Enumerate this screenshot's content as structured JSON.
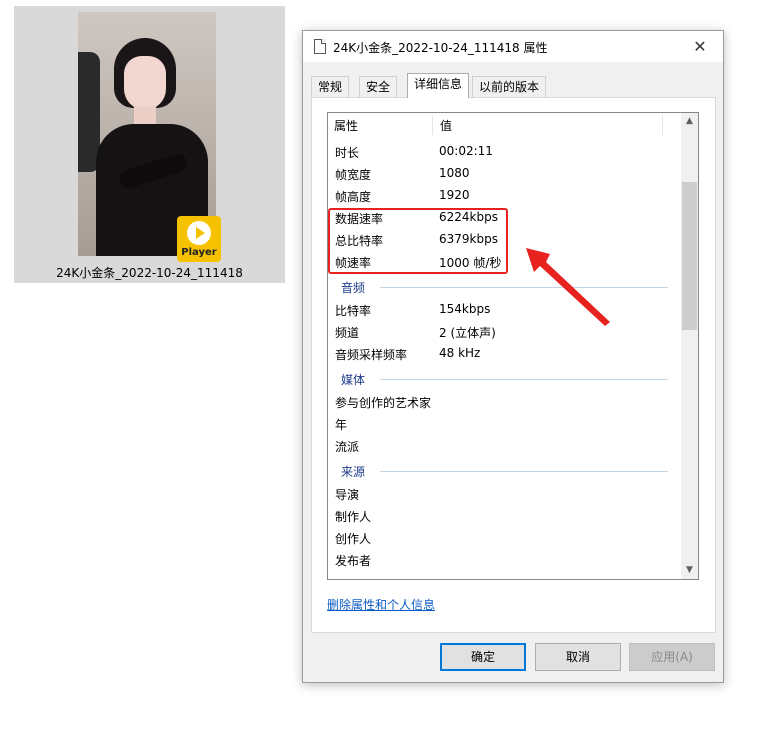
{
  "file": {
    "name": "24K小金条_2022-10-24_111418",
    "badge_label": "Player",
    "badge_color": "#f6c200"
  },
  "dialog": {
    "title": "24K小金条_2022-10-24_111418 属性",
    "close_glyph": "✕",
    "tabs": [
      "常规",
      "安全",
      "详细信息",
      "以前的版本"
    ],
    "active_tab": "详细信息",
    "columns": {
      "name": "属性",
      "value": "值"
    },
    "rows": [
      {
        "k": "时长",
        "v": "00:02:11"
      },
      {
        "k": "帧宽度",
        "v": "1080"
      },
      {
        "k": "帧高度",
        "v": "1920"
      },
      {
        "k": "数据速率",
        "v": "6224kbps"
      },
      {
        "k": "总比特率",
        "v": "6379kbps"
      },
      {
        "k": "帧速率",
        "v": "1000 帧/秒"
      }
    ],
    "group_audio": "音频",
    "audio_rows": [
      {
        "k": "比特率",
        "v": "154kbps"
      },
      {
        "k": "频道",
        "v": "2 (立体声)"
      },
      {
        "k": "音频采样频率",
        "v": "48 kHz"
      }
    ],
    "group_media": "媒体",
    "media_rows": [
      {
        "k": "参与创作的艺术家",
        "v": ""
      },
      {
        "k": "年",
        "v": ""
      },
      {
        "k": "流派",
        "v": ""
      }
    ],
    "group_source": "来源",
    "source_rows": [
      {
        "k": "导演",
        "v": ""
      },
      {
        "k": "制作人",
        "v": ""
      },
      {
        "k": "创作人",
        "v": ""
      },
      {
        "k": "发布者",
        "v": ""
      }
    ],
    "remove_link": "删除属性和个人信息",
    "buttons": {
      "ok": "确定",
      "cancel": "取消",
      "apply": "应用(A)"
    }
  },
  "colors": {
    "highlight": "#e8231f",
    "link": "#0a5bc4",
    "group_header": "#1e3c8c"
  }
}
